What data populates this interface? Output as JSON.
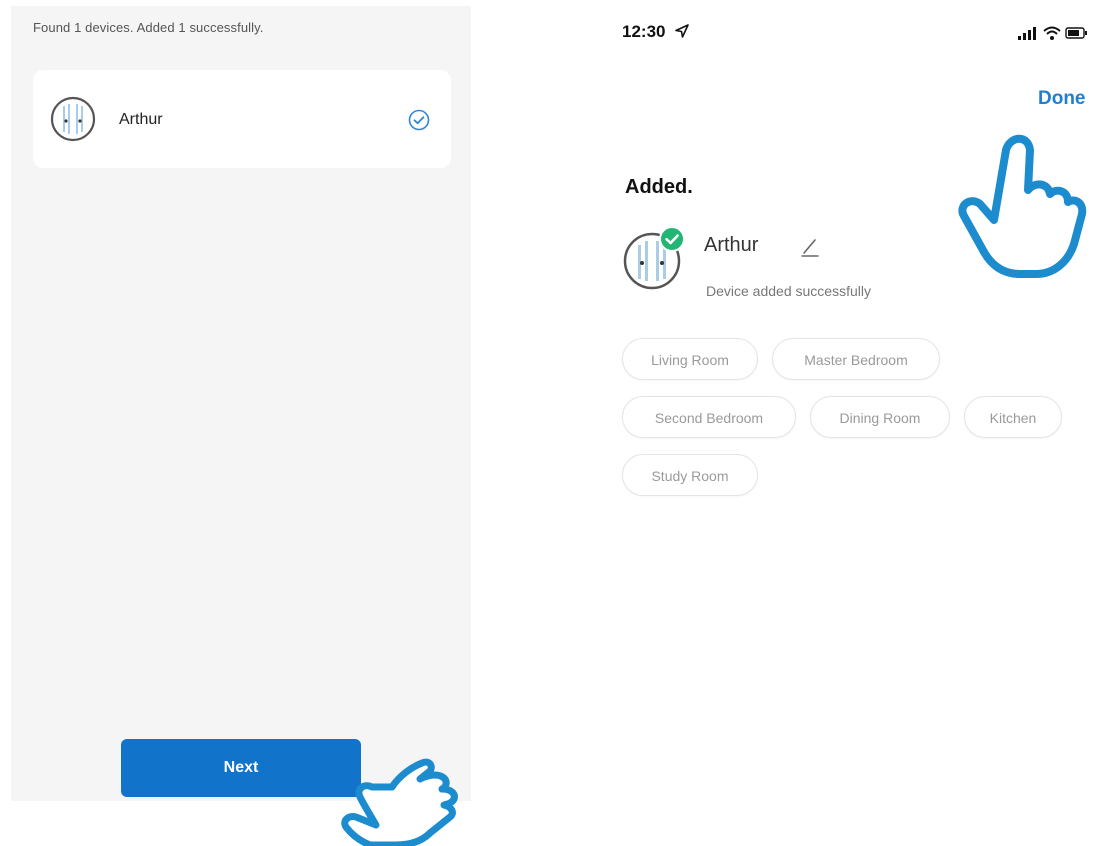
{
  "left": {
    "found_text": "Found 1 devices. Added 1 successfully.",
    "device": {
      "name": "Arthur",
      "avatar_icon": "air-purifier-icon",
      "status_icon": "check-circle-icon"
    },
    "next_label": "Next"
  },
  "right": {
    "status_bar": {
      "time": "12:30",
      "location_icon": "location-arrow-icon",
      "icons": [
        "signal-icon",
        "wifi-icon",
        "battery-icon"
      ]
    },
    "done_label": "Done",
    "title": "Added.",
    "device": {
      "name": "Arthur",
      "subtitle": "Device added successfully",
      "badge_icon": "success-check-icon",
      "edit_icon": "pencil-icon"
    },
    "rooms": [
      "Living Room",
      "Master Bedroom",
      "Second Bedroom",
      "Dining Room",
      "Kitchen",
      "Study Room"
    ]
  },
  "colors": {
    "primary_blue": "#1173c9",
    "link_blue": "#1f7fd1",
    "success_green": "#22b573",
    "hand_outline": "#1c8ccf",
    "panel_bg": "#f5f5f6"
  }
}
